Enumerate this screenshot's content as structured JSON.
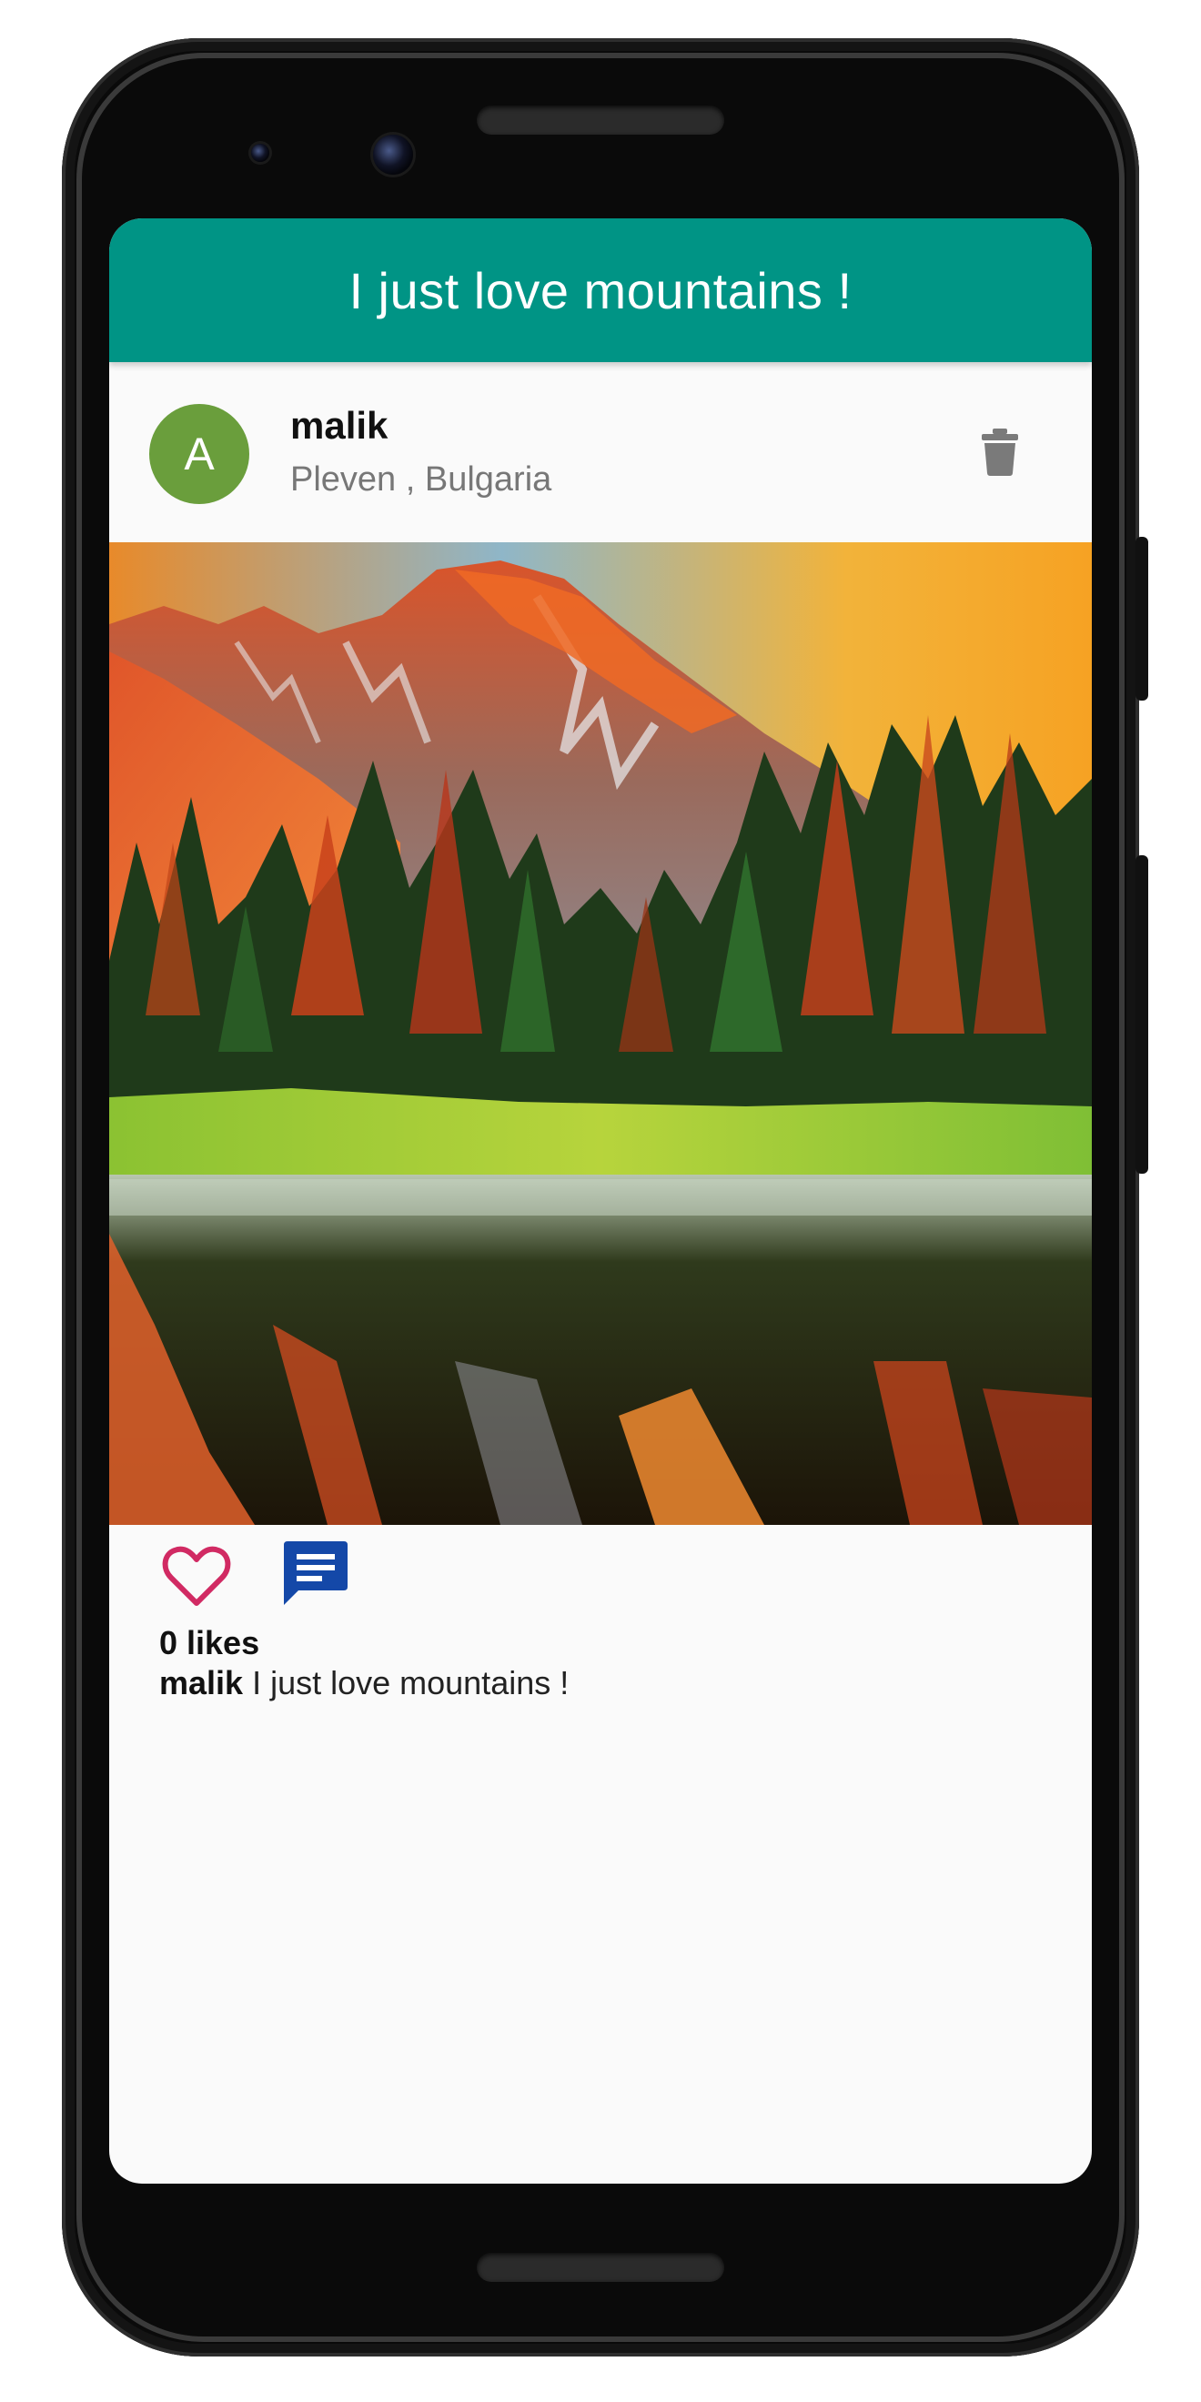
{
  "app": {
    "title": "I just love mountains !"
  },
  "post": {
    "avatar_letter": "A",
    "username": "malik",
    "location": "Pleven , Bulgaria",
    "likes_text": "0 likes",
    "caption_user": "malik",
    "caption_text": "I just love mountains !",
    "image_subject": "mountain-lake-landscape"
  },
  "icons": {
    "delete": "trash-icon",
    "like": "heart-outline-icon",
    "comment": "comment-icon"
  },
  "colors": {
    "appbar": "#009485",
    "avatar": "#6a9e3c",
    "like": "#d12a63",
    "comment": "#1448a8",
    "delete": "#7a7a7a"
  }
}
